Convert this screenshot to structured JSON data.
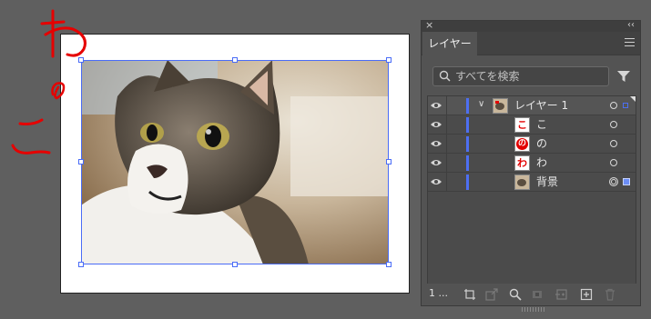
{
  "canvas": {
    "artboard_bg": "#ffffff",
    "stray_characters": [
      "わ",
      "の",
      "こ"
    ],
    "stray_color": "#e60000",
    "selection_color": "#4a6cf7"
  },
  "panel": {
    "tab_label": "レイヤー",
    "close_icon": "close-icon",
    "collapse_icon": "double-chevron-icon",
    "menu_icon": "hamburger-menu-icon",
    "search_placeholder": "すべてを検索",
    "filter_icon": "filter-icon",
    "layers": [
      {
        "name": "レイヤー 1",
        "thumb": "photo",
        "expanded": true
      },
      {
        "name": "こ",
        "thumb": "こ",
        "thumb_style": "plain"
      },
      {
        "name": "の",
        "thumb": "の",
        "thumb_style": "inverted"
      },
      {
        "name": "わ",
        "thumb": "わ",
        "thumb_style": "plain"
      },
      {
        "name": "背景",
        "thumb": "photo"
      }
    ],
    "layer_color": "#4d6ff2",
    "footer": {
      "count_label": "1 ...",
      "icons": [
        "artboard-icon",
        "export-icon",
        "locate-object-icon",
        "clipping-mask-icon",
        "new-sublayer-icon",
        "new-layer-icon",
        "trash-icon"
      ]
    }
  }
}
